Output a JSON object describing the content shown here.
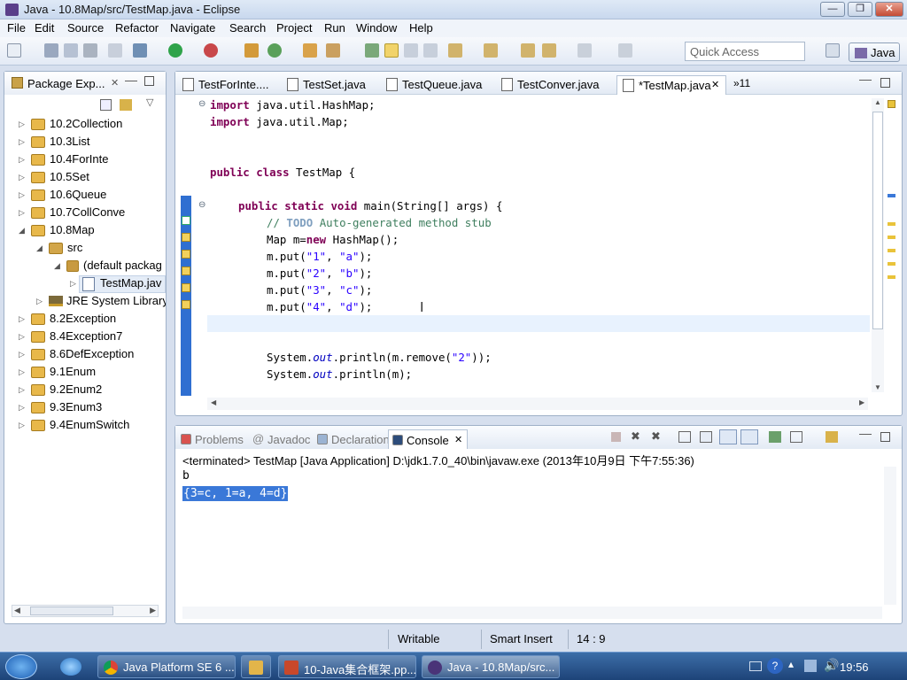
{
  "window": {
    "title": "Java - 10.8Map/src/TestMap.java - Eclipse",
    "min": "—",
    "max": "❐",
    "close": "✕"
  },
  "menu": [
    "File",
    "Edit",
    "Source",
    "Refactor",
    "Navigate",
    "Search",
    "Project",
    "Run",
    "Window",
    "Help"
  ],
  "toolbar": {
    "quick_access_placeholder": "Quick Access",
    "perspective": "Java"
  },
  "package_explorer": {
    "title": "Package Exp...",
    "items": [
      {
        "label": "10.2Collection"
      },
      {
        "label": "10.3List"
      },
      {
        "label": "10.4ForInte"
      },
      {
        "label": "10.5Set"
      },
      {
        "label": "10.6Queue"
      },
      {
        "label": "10.7CollConve"
      },
      {
        "label": "10.8Map"
      },
      {
        "label": "src"
      },
      {
        "label": "(default packag"
      },
      {
        "label": "TestMap.jav"
      },
      {
        "label": "JRE System Library"
      },
      {
        "label": "8.2Exception"
      },
      {
        "label": "8.4Exception7"
      },
      {
        "label": "8.6DefException"
      },
      {
        "label": "9.1Enum"
      },
      {
        "label": "9.2Enum2"
      },
      {
        "label": "9.3Enum3"
      },
      {
        "label": "9.4EnumSwitch"
      }
    ]
  },
  "editor": {
    "tabs": [
      "TestForInte....",
      "TestSet.java",
      "TestQueue.java",
      "TestConver.java",
      "*TestMap.java"
    ],
    "overflow": "»11",
    "code": {
      "l1_kw": "import",
      "l1_rest": " java.util.HashMap;",
      "l2_kw": "import",
      "l2_rest": " java.util.Map;",
      "l3_kw1": "public",
      "l3_kw2": " class",
      "l3_rest": " TestMap {",
      "l4_kw1": "public",
      "l4_kw2": " static",
      "l4_kw3": " void",
      "l4_rest": " main(String[] args) {",
      "l5_pre": "// ",
      "l5_todo": "TODO",
      "l5_rest": " Auto-generated method stub",
      "l6_a": "Map m=",
      "l6_kw": "new",
      "l6_b": " HashMap();",
      "put1_a": "m.put(",
      "put1_k": "\"1\"",
      "put1_c": ", ",
      "put1_v": "\"a\"",
      "put1_e": ");",
      "put2_a": "m.put(",
      "put2_k": "\"2\"",
      "put2_c": ", ",
      "put2_v": "\"b\"",
      "put2_e": ");",
      "put3_a": "m.put(",
      "put3_k": "\"3\"",
      "put3_c": ", ",
      "put3_v": "\"c\"",
      "put3_e": ");",
      "put4_a": "m.put(",
      "put4_k": "\"4\"",
      "put4_c": ", ",
      "put4_v": "\"d\"",
      "put4_e": ");",
      "p1_a": "System.",
      "p1_out": "out",
      "p1_b": ".println(m.remove(",
      "p1_s": "\"2\"",
      "p1_c": "));",
      "p2_a": "System.",
      "p2_out": "out",
      "p2_b": ".println(m);"
    }
  },
  "console": {
    "tabs": [
      "Problems",
      "Javadoc",
      "Declaration",
      "Console"
    ],
    "info": "<terminated> TestMap [Java Application] D:\\jdk1.7.0_40\\bin\\javaw.exe (2013年10月9日 下午7:55:36)",
    "output": [
      "b",
      "{3=c, 1=a, 4=d}"
    ]
  },
  "status": {
    "writable": "Writable",
    "insert_mode": "Smart Insert",
    "position": "14 : 9"
  },
  "taskbar": {
    "items": [
      "Java Platform SE 6 ...",
      "",
      "10-Java集合框架.pp...",
      "Java - 10.8Map/src..."
    ],
    "clock": "19:56"
  },
  "colors": {
    "keyword": "#7f0055",
    "string": "#2a00ff",
    "comment": "#3f7f5f",
    "selection": "#3a78d8"
  }
}
